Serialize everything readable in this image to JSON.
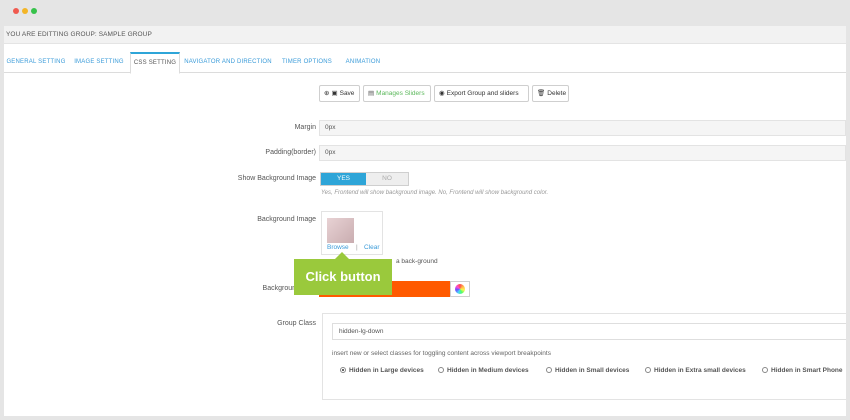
{
  "header": {
    "title": "YOU ARE EDITTING GROUP: SAMPLE GROUP"
  },
  "tabs": [
    {
      "label": "GENERAL SETTING"
    },
    {
      "label": "IMAGE SETTING"
    },
    {
      "label": "CSS SETTING"
    },
    {
      "label": "NAVIGATOR AND DIRECTION"
    },
    {
      "label": "TIMER OPTIONS"
    },
    {
      "label": "ANIMATION"
    }
  ],
  "toolbar": {
    "save": "Save",
    "manage": "Manages Sliders",
    "export": "Export Group and sliders",
    "delete": "Delete"
  },
  "form": {
    "margin_label": "Margin",
    "margin_value": "0px",
    "padding_label": "Padding(border)",
    "padding_value": "0px",
    "show_bg_label": "Show Background Image",
    "yes": "YES",
    "no": "NO",
    "show_bg_help": "Yes, Frontend will show background image. No, Frontend will show background color.",
    "bg_image_label": "Background Image",
    "browse": "Browse",
    "separator": "|",
    "clear": "Clear",
    "bg_image_help_partial": "a back-ground",
    "bg_color_label_partial": "Backgroun",
    "bg_color": "#ff5a00",
    "group_class_label": "Group Class",
    "group_class_value": "hidden-lg-down",
    "group_class_help": "insert new or select classes for toggling content across viewport breakpoints",
    "radios": [
      {
        "label": "Hidden in Large devices",
        "checked": true
      },
      {
        "label": "Hidden in Medium devices",
        "checked": false
      },
      {
        "label": "Hidden in Small devices",
        "checked": false
      },
      {
        "label": "Hidden in Extra small devices",
        "checked": false
      },
      {
        "label": "Hidden in Smart Phone",
        "checked": false
      }
    ]
  },
  "callout": {
    "text": "Click button"
  },
  "colors": {
    "accent": "#2ea5d8",
    "callout": "#9ac93c",
    "link": "#3a9bd9"
  }
}
